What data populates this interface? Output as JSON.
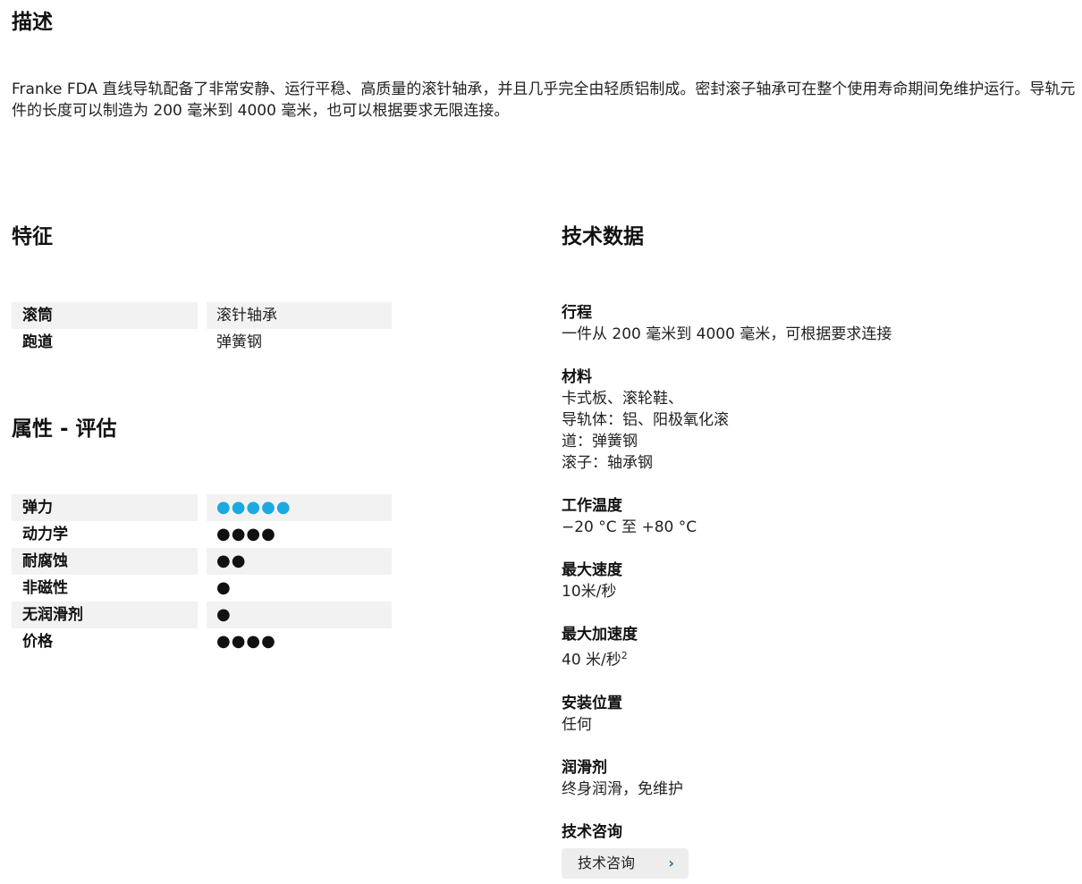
{
  "description": {
    "title": "描述",
    "text": "Franke FDA 直线导轨配备了非常安静、运行平稳、高质量的滚针轴承，并且几乎完全由轻质铝制成。密封滚子轴承可在整个使用寿命期间免维护运行。导轨元件的长度可以制造为 200 毫米到 4000 毫米，也可以根据要求无限连接。"
  },
  "features": {
    "title": "特征",
    "rows": [
      {
        "label": "滚筒",
        "value": "滚针轴承"
      },
      {
        "label": "跑道",
        "value": "弹簧钢"
      }
    ]
  },
  "ratings": {
    "title": "属性 - 评估",
    "rows": [
      {
        "label": "弹力",
        "dots": "●●●●●",
        "color": "#1aa9e0"
      },
      {
        "label": "动力学",
        "dots": "●●●●",
        "color": "#111111"
      },
      {
        "label": "耐腐蚀",
        "dots": "●●",
        "color": "#111111"
      },
      {
        "label": "非磁性",
        "dots": "●",
        "color": "#111111"
      },
      {
        "label": "无润滑剂",
        "dots": "●",
        "color": "#111111"
      },
      {
        "label": "价格",
        "dots": "●●●●",
        "color": "#111111"
      }
    ]
  },
  "tech": {
    "title": "技术数据",
    "stroke_label": "行程",
    "stroke_value": "一件从 200 毫米到 4000 毫米，可根据要求连接",
    "material_label": "材料",
    "material_lines": [
      "卡式板、滚轮鞋、",
      "导轨体：铝、阳极氧化滚",
      "道：弹簧钢",
      "滚子：轴承钢"
    ],
    "temp_label": "工作温度",
    "temp_value": "−20 °C 至 +80 °C",
    "speed_label": "最大速度",
    "speed_value": "10米/秒",
    "accel_label": "最大加速度",
    "accel_value": "40 米/秒",
    "accel_sup": "2",
    "mount_label": "安装位置",
    "mount_value": "任何",
    "lube_label": "润滑剂",
    "lube_value": "终身润滑，免维护",
    "consult_label": "技术咨询",
    "consult_button": "技术咨询"
  },
  "colors": {
    "accent": "#1aa9e0",
    "row_shade": "#f2f2f2",
    "button_bg": "#ededed"
  }
}
